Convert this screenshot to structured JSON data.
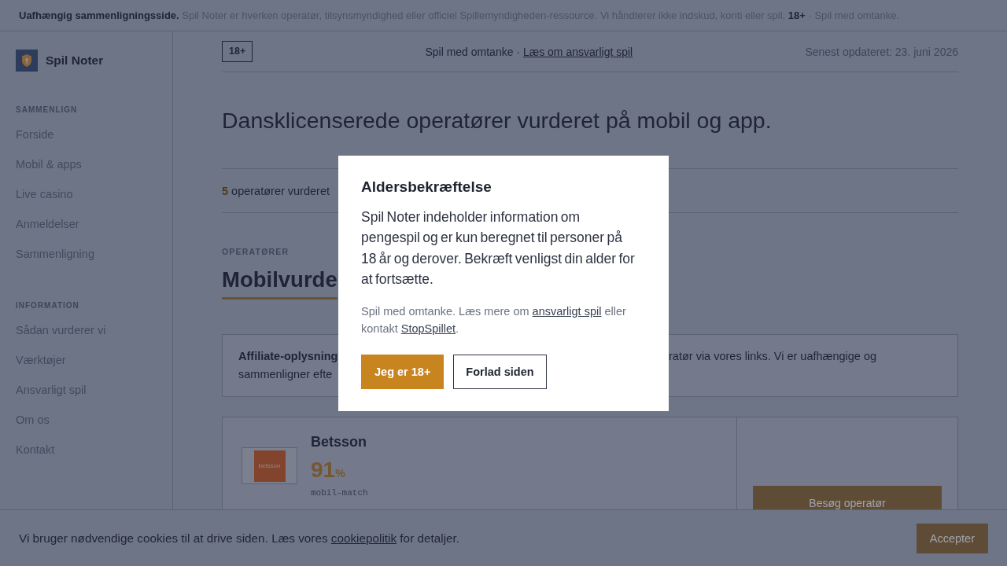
{
  "notice_bar": {
    "text": "**Uafhængig sammenligningsside.** Spil Noter er hverken operatør, tilsynsmyndighed eller officiel Spillemyndigheden-ressource. Vi håndterer ikke indskud, konti eller spil. **18+** · Spil med omtanke."
  },
  "sidebar": {
    "brand": "Spil Noter",
    "sections": [
      {
        "heading": "SAMMENLIGN",
        "items": [
          "Forside",
          "Mobil & apps",
          "Live casino",
          "Anmeldelser",
          "Sammenligning"
        ]
      },
      {
        "heading": "INFORMATION",
        "items": [
          "Sådan vurderer vi",
          "Værktøjer",
          "Ansvarligt spil",
          "Om os",
          "Kontakt"
        ]
      }
    ]
  },
  "header": {
    "age_badge": "18+",
    "note": [
      {
        "kind": "text",
        "text": "Spil med omtanke · "
      },
      {
        "kind": "link",
        "text": "Læs om ansvarligt spil"
      }
    ],
    "updated": "Senest opdateret: 23. juni 2026"
  },
  "page_title": "Dansklicenserede operatører vurderet på mobil og app.",
  "stats": {
    "count": "5",
    "label": "operatører vurderet"
  },
  "operators": {
    "eyebrow": "OPERATØRER",
    "heading": "Mobilvurde",
    "affiliate_notice": {
      "label": "Affiliate-oplysning",
      "text_right": "ratør via vores links. Vi er uafhængige og",
      "text_left": "sammenligner efte"
    },
    "cards": [
      {
        "name": "Betsson",
        "logo_text": "betsson",
        "score": "91",
        "score_unit": "%",
        "score_label": "mobil-match",
        "button": "Besøg operatør"
      }
    ]
  },
  "cookie_bar": {
    "text": [
      {
        "kind": "text",
        "text": "Vi bruger nødvendige cookies til at drive siden. Læs vores "
      },
      {
        "kind": "link",
        "text": "cookiepolitik"
      },
      {
        "kind": "text",
        "text": " for detaljer."
      }
    ],
    "button": "Accepter"
  },
  "age_dialog": {
    "title": "Aldersbekræftelse",
    "text": "Spil Noter indeholder information om pengespil og er kun beregnet til personer på 18 år og derover. Bekræft venligst din alder for at fortsætte.",
    "note": [
      {
        "kind": "text",
        "text": "Spil med omtanke. Læs mere om "
      },
      {
        "kind": "link",
        "text": "ansvarligt spil"
      },
      {
        "kind": "text",
        "text": " eller kontakt "
      },
      {
        "kind": "link",
        "text": "StopSpillet"
      },
      {
        "kind": "text",
        "text": "."
      }
    ],
    "buttons": [
      {
        "label": "Jeg er 18+",
        "kind": "primary"
      },
      {
        "label": "Forlad siden",
        "kind": "secondary"
      }
    ]
  }
}
